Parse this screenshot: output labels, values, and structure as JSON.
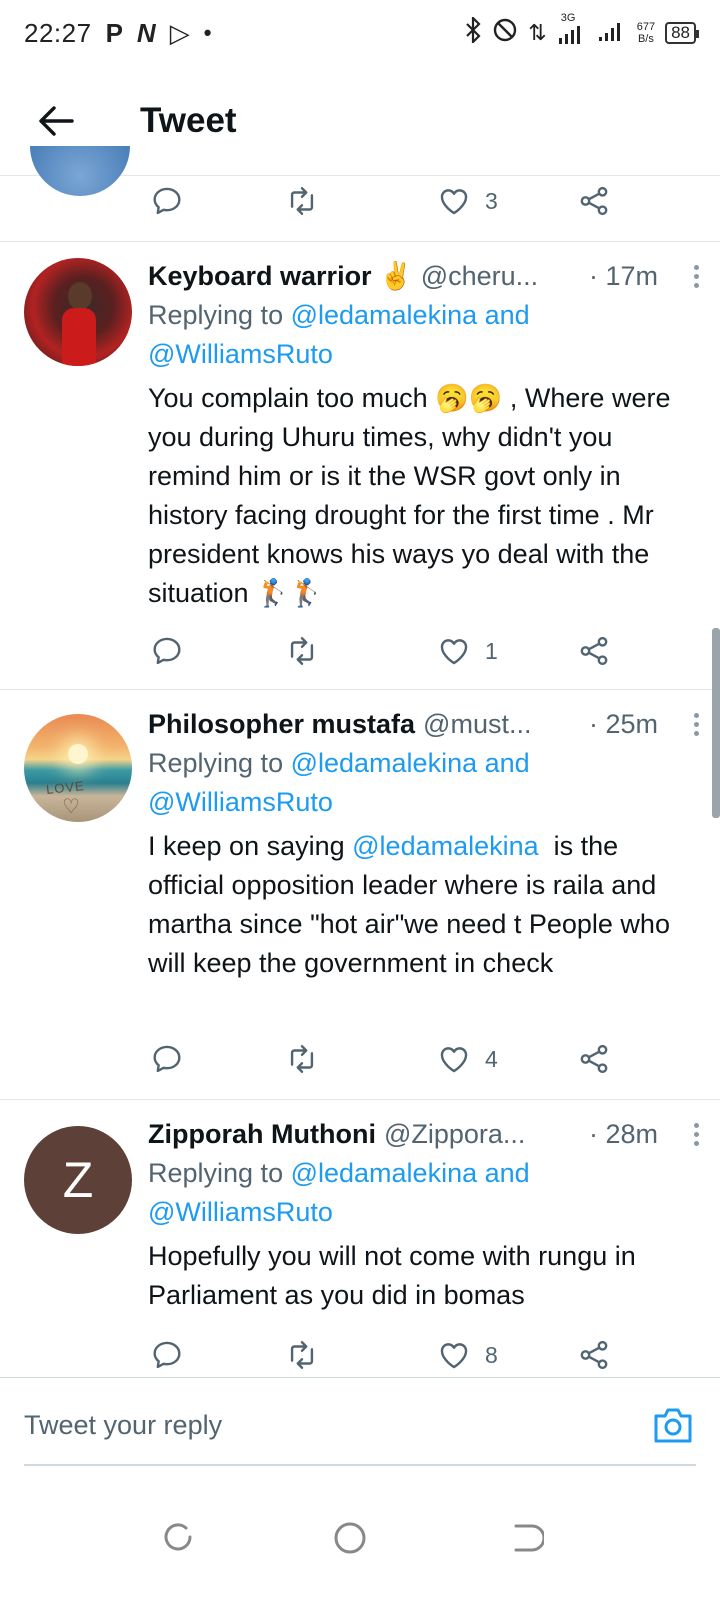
{
  "status_bar": {
    "time": "22:27",
    "left_icons": [
      "P",
      "N",
      "▷",
      "•"
    ],
    "net_speed_value": "677",
    "net_speed_unit": "B/s",
    "network": "3G",
    "battery": "88"
  },
  "header": {
    "title": "Tweet"
  },
  "partial_tweet": {
    "like_count": "3"
  },
  "tweets": [
    {
      "name": "Keyboard warrior ✌️",
      "handle": "@cheru...",
      "time": "· 17m",
      "replying_prefix": "Replying to ",
      "replying_to": "@ledamalekina and @WilliamsRuto",
      "text": "You complain too much 🥱🥱 , Where were you during Uhuru times, why didn't you remind him or is it the WSR govt only in history facing drought for the first time . Mr president knows his ways yo deal with the situation 🏌🏌",
      "like_count": "1"
    },
    {
      "name": "Philosopher mustafa",
      "handle": "@must...",
      "time": "· 25m",
      "replying_prefix": "Replying to ",
      "replying_to": "@ledamalekina and @WilliamsRuto",
      "text_before": "I keep on saying ",
      "text_mention": "@ledamalekina",
      "text_after": "  is the official opposition leader where is raila and martha since \"hot air\"we need t People who will keep the government in check",
      "avatar_text": "LOVE",
      "like_count": "4"
    },
    {
      "name": "Zipporah Muthoni",
      "handle": "@Zippora...",
      "time": "· 28m",
      "replying_prefix": "Replying to ",
      "replying_to": "@ledamalekina and @WilliamsRuto",
      "text": "Hopefully you will not come with rungu in Parliament as you did in bomas",
      "avatar_letter": "Z",
      "like_count": "8"
    }
  ],
  "composer": {
    "placeholder": "Tweet your reply"
  },
  "colors": {
    "link": "#1d9bf0",
    "secondary_text": "#536471",
    "divider": "#e1e8ed"
  }
}
